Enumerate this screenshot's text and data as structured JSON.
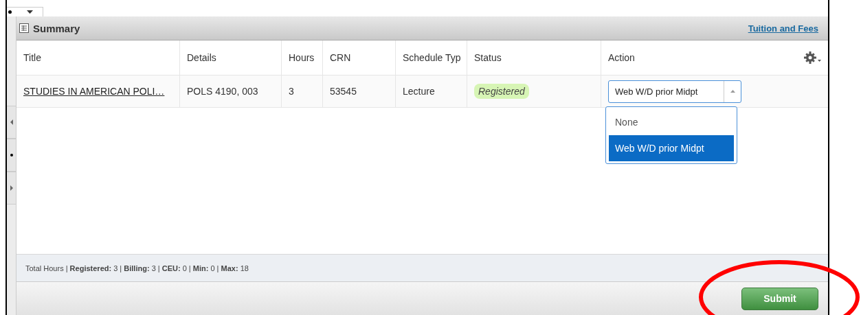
{
  "panel": {
    "title": "Summary",
    "link": "Tuition and Fees"
  },
  "table": {
    "columns": [
      "Title",
      "Details",
      "Hours",
      "CRN",
      "Schedule Typ",
      "Status",
      "Action"
    ],
    "rows": [
      {
        "title": "STUDIES IN AMERICAN POLI…",
        "details": "POLS 4190, 003",
        "hours": "3",
        "crn": "53545",
        "schedule_type": "Lecture",
        "status": "Registered",
        "action": "Web W/D prior Midpt"
      }
    ]
  },
  "action_dropdown": {
    "expanded": true,
    "options": [
      {
        "label": "None",
        "selected": false
      },
      {
        "label": "Web W/D prior Midpt",
        "selected": true
      }
    ]
  },
  "footer": "Total Hours | **Registered:** 3 | **Billing:** 3 | **CEU:** 0 | **Min:** 0 | **Max:** 18",
  "submit": "Submit"
}
